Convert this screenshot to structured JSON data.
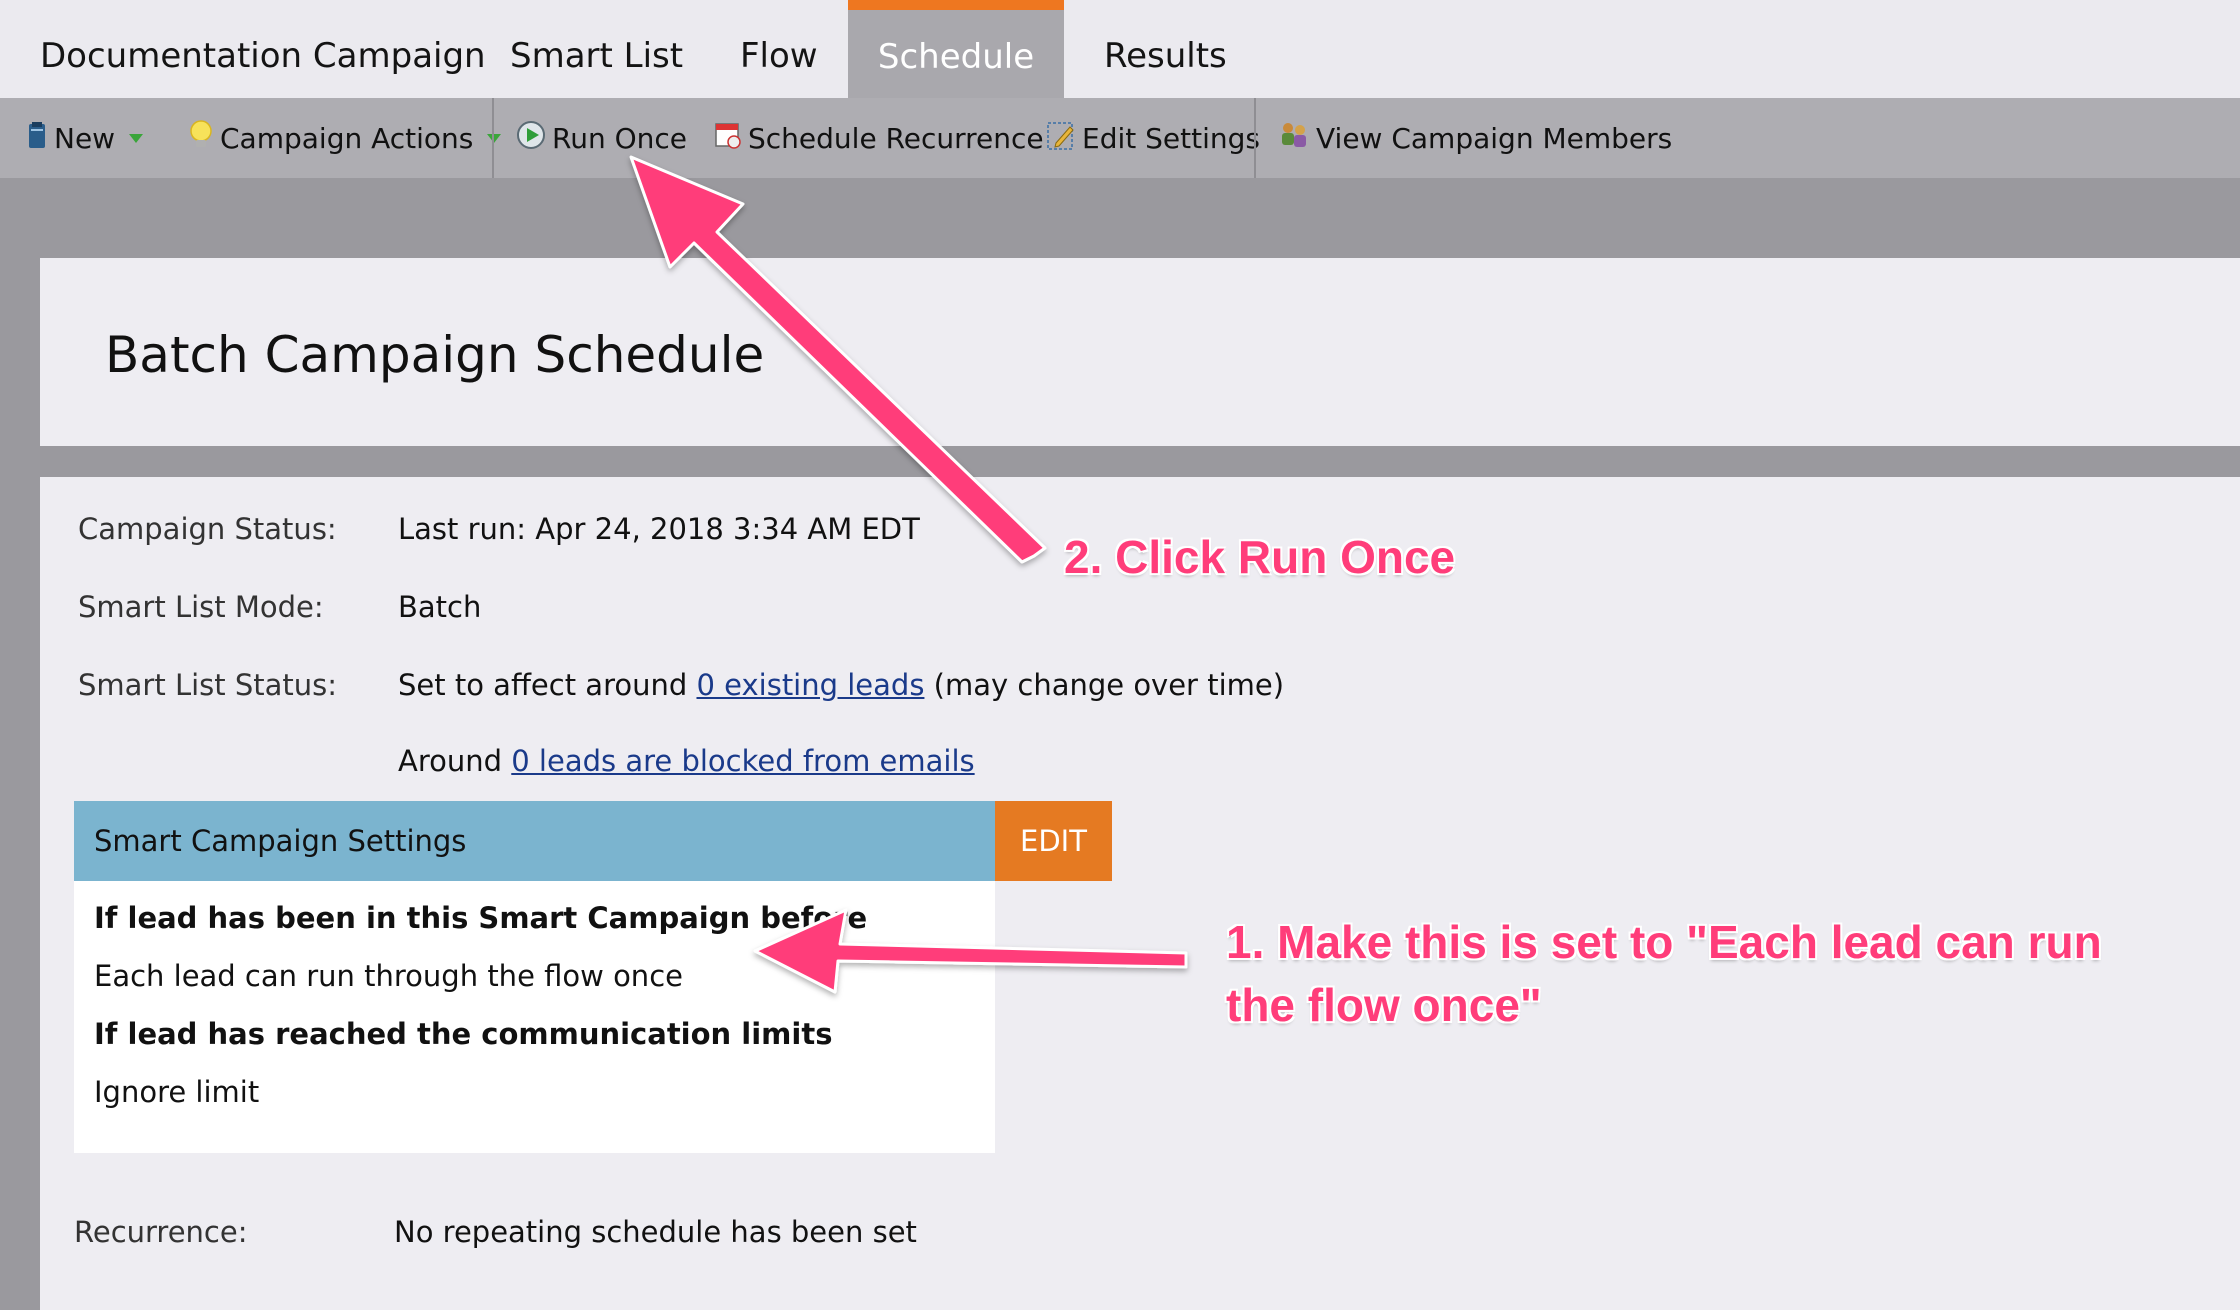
{
  "tabs": [
    {
      "label": "Documentation Campaign",
      "active": false
    },
    {
      "label": "Smart List",
      "active": false
    },
    {
      "label": "Flow",
      "active": false
    },
    {
      "label": "Schedule",
      "active": true
    },
    {
      "label": "Results",
      "active": false
    }
  ],
  "toolbar": {
    "new_label": "New",
    "campaign_actions_label": "Campaign Actions",
    "run_once_label": "Run Once",
    "schedule_recurrence_label": "Schedule Recurrence",
    "edit_settings_label": "Edit Settings",
    "view_members_label": "View Campaign Members"
  },
  "page": {
    "title": "Batch Campaign Schedule"
  },
  "details": {
    "status_label": "Campaign Status:",
    "status_value": "Last run: Apr 24, 2018 3:34 AM EDT",
    "mode_label": "Smart List Mode:",
    "mode_value": "Batch",
    "list_status_label": "Smart List Status:",
    "list_status_prefix": "Set to affect around",
    "list_status_link": "0 existing leads",
    "list_status_suffix": "(may change over time)",
    "blocked_prefix": "Around",
    "blocked_link": "0 leads are blocked from emails",
    "recurrence_label": "Recurrence:",
    "recurrence_value": "No repeating schedule has been set"
  },
  "settings": {
    "title": "Smart Campaign Settings",
    "edit_label": "EDIT",
    "q1": "If lead has been in this Smart Campaign before",
    "a1": "Each lead can run through the flow once",
    "q2": "If lead has reached the communication limits",
    "a2": "Ignore limit"
  },
  "annotations": {
    "step2": "2. Click Run Once",
    "step1_line1": "1. Make this is set to \"Each lead can run",
    "step1_line2": "the flow once\""
  },
  "colors": {
    "accent": "#ee7720",
    "settings_header": "#7bb4cf",
    "edit_button": "#e57a22",
    "annotation": "#ff3d7a"
  }
}
